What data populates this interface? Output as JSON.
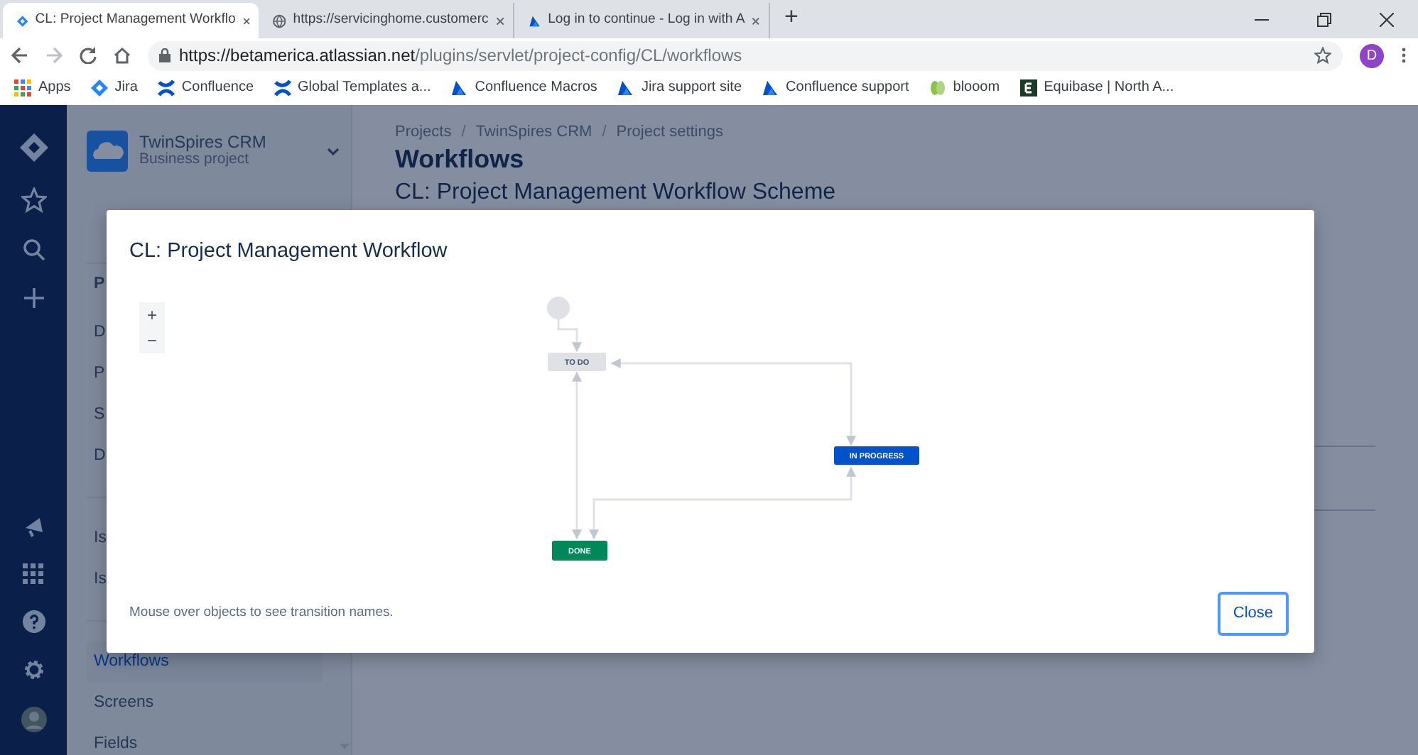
{
  "browser": {
    "tabs": [
      {
        "title": "CL: Project Management Workflo",
        "kind": "diamond",
        "selected": true
      },
      {
        "title": "https://servicinghome.customerc",
        "kind": "globe",
        "selected": false
      },
      {
        "title": "Log in to continue - Log in with A",
        "kind": "triangle",
        "selected": false
      }
    ],
    "new_tab": "+",
    "address": {
      "host": "https://betamerica.atlassian.net",
      "path": "/plugins/servlet/project-config/CL/workflows"
    },
    "profile_initial": "D",
    "bookmarks": [
      {
        "label": "Apps",
        "kind": "grid"
      },
      {
        "label": "Jira",
        "kind": "diamond"
      },
      {
        "label": "Confluence",
        "kind": "cross"
      },
      {
        "label": "Global Templates a...",
        "kind": "cross"
      },
      {
        "label": "Confluence Macros",
        "kind": "triangle"
      },
      {
        "label": "Jira support site",
        "kind": "triangle"
      },
      {
        "label": "Confluence support",
        "kind": "triangle"
      },
      {
        "label": "blooom",
        "kind": "sprout"
      },
      {
        "label": "Equibase | North A...",
        "kind": "square"
      }
    ]
  },
  "project": {
    "name": "TwinSpires CRM",
    "type": "Business project"
  },
  "sidebar": {
    "items": [
      {
        "label": "P",
        "kind": "heading",
        "selected": false
      },
      {
        "label": "D",
        "kind": "item",
        "selected": false
      },
      {
        "label": "P",
        "kind": "item",
        "selected": false
      },
      {
        "label": "S",
        "kind": "item",
        "selected": false
      },
      {
        "label": "D",
        "kind": "item",
        "selected": false
      },
      {
        "label": "Is",
        "kind": "item",
        "selected": false
      },
      {
        "label": "Is",
        "kind": "item",
        "selected": false
      },
      {
        "label": "Workflows",
        "kind": "item",
        "selected": true
      },
      {
        "label": "Screens",
        "kind": "item",
        "selected": false
      },
      {
        "label": "Fields",
        "kind": "item",
        "selected": false
      }
    ]
  },
  "page": {
    "breadcrumbs": [
      {
        "text": "Projects",
        "kind": "link"
      },
      {
        "text": "/",
        "kind": "separator"
      },
      {
        "text": "TwinSpires CRM",
        "kind": "link"
      },
      {
        "text": "/",
        "kind": "separator"
      },
      {
        "text": "Project settings",
        "kind": "link"
      }
    ],
    "title": "Workflows",
    "subtitle": "CL: Project Management Workflow Scheme"
  },
  "dialog": {
    "title": "CL: Project Management Workflow",
    "zoom_in": "+",
    "zoom_out": "−",
    "workflow": {
      "nodes": [
        {
          "kind": "start"
        },
        {
          "kind": "status",
          "label": "TO DO",
          "color": "#dfe1e6"
        },
        {
          "kind": "status",
          "label": "IN PROGRESS",
          "color": "#0052cc"
        },
        {
          "kind": "status",
          "label": "DONE",
          "color": "#00875a"
        }
      ]
    },
    "hint": "Mouse over objects to see transition names.",
    "close_button": "Close"
  }
}
